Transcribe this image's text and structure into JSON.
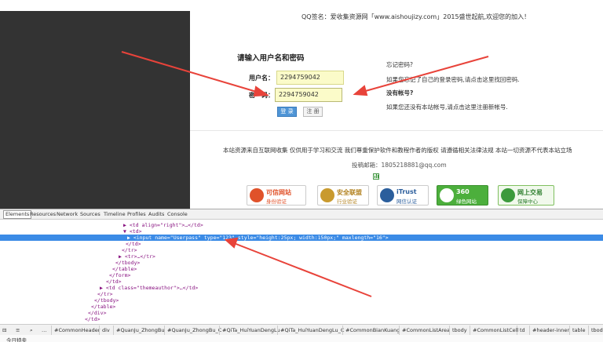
{
  "page": {
    "qq_line": "QQ签名：爱收集资源网「www.aishoujizy.com」2015盛世起航,欢迎您的加入！",
    "login_title": "请输入用户名和密码",
    "username_label": "用户名：",
    "username_value": "2294759042",
    "password_label": "密　码：",
    "password_value": "2294759042",
    "login_button": "登 录",
    "register_button": "注 册",
    "forgot_title": "忘记密码?",
    "forgot_text": "如果您忘记了自己的登录密码,请点击这里找回密码.",
    "no_account_title": "没有帐号?",
    "no_account_text": "如果您还没有本站帐号,请点击这里注册新帐号.",
    "disclaimer": "本站资源来自互联网收集 仅供用于学习和交流 我们尊重保护软件和教程作者的版权 请遵循相关法律法规 本站一切资源不代表本站立场",
    "email_line": "投稿邮箱：1805218881@qq.com",
    "badges": [
      {
        "t1": "可信网站",
        "t2": "身份验证",
        "color": "#e0522a"
      },
      {
        "t1": "安全联盟",
        "t2": "行业验证",
        "color": "#c99a2e"
      },
      {
        "t1": "iTrust",
        "t2": "网信认证",
        "color": "#2b5e9c"
      },
      {
        "t1": "360",
        "t2": "绿色网站",
        "color": "#3aa53a"
      },
      {
        "t1": "网上交易",
        "t2": "保障中心",
        "color": "#3c9a3c"
      }
    ]
  },
  "devtools": {
    "tabs": [
      "Elements",
      "Resources",
      "Network",
      "Sources",
      "Timeline",
      "Profiles",
      "Audits",
      "Console"
    ],
    "dom_lines": [
      {
        "t": "▶ <td align=\"right\">…</td>"
      },
      {
        "t": "▼ <td>"
      },
      {
        "t": "<input name=\"Userpass\" type=\"123\" style=\"height:25px; width:150px;\" maxlength=\"16\">"
      },
      {
        "t": "</td>"
      },
      {
        "t": "</tr>"
      },
      {
        "t": "▶ <tr>…</tr>"
      },
      {
        "t": "</tbody>"
      },
      {
        "t": "</table>"
      },
      {
        "t": "</form>"
      },
      {
        "t": "</td>"
      },
      {
        "t": "▶ <td class=\"themeauthor\">…</td>"
      },
      {
        "t": "</tr>"
      },
      {
        "t": "</tbody>"
      },
      {
        "t": "</table>"
      },
      {
        "t": "</div>"
      },
      {
        "t": "</td>"
      }
    ],
    "breadcrumbs": [
      "…",
      "#CommonHeader",
      "div",
      "#QuanJu_ZhongBu",
      "#QuanJu_ZhongBu_C",
      "#QiTa_HuiYuanDengLu",
      "#QiTa_HuiYuanDengLu_C",
      "#CommonBianKuang",
      "#CommonListArea",
      "tbody",
      "#CommonListCell",
      "td",
      "#header-inner",
      "table",
      "tbody"
    ],
    "status_text": "今日特卖"
  },
  "colors": {
    "arrow": "#e8433a",
    "selection": "#3b8be6",
    "dark_panel": "#333333"
  }
}
